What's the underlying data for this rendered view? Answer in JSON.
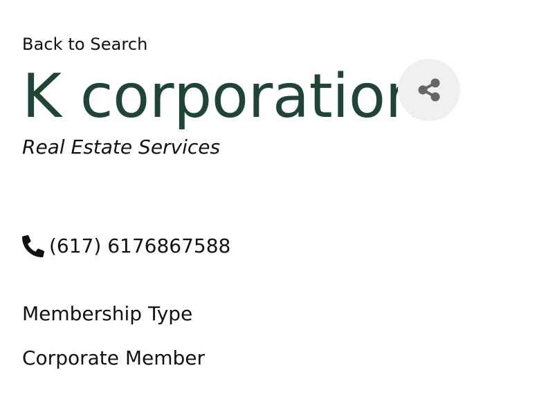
{
  "nav": {
    "back_label": "Back to Search"
  },
  "company": {
    "name": "K corporation",
    "category": "Real Estate Services",
    "phone": "(617) 6176867588"
  },
  "membership": {
    "label": "Membership Type",
    "value": "Corporate Member"
  },
  "icons": {
    "share": "share-icon",
    "phone": "phone-icon"
  },
  "colors": {
    "title": "#1f4534",
    "share_bg": "#f0f0f0",
    "share_icon": "#666666",
    "text": "#111111"
  }
}
